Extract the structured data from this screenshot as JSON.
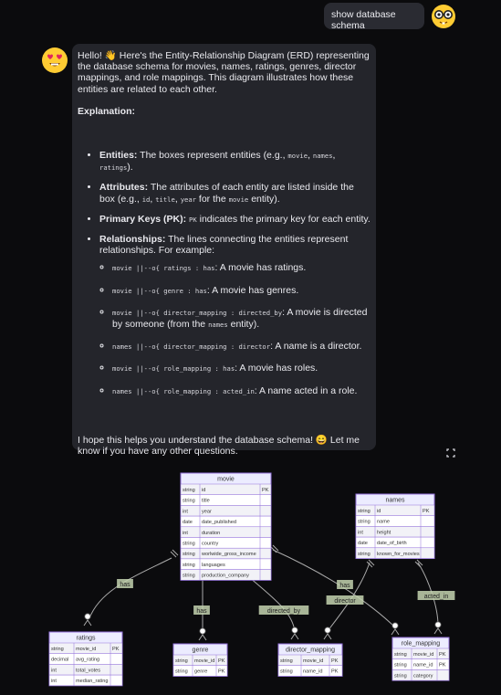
{
  "user_message": "show database schema",
  "assistant": {
    "intro": "Hello! 👋 Here's the Entity-Relationship Diagram (ERD) representing the database schema for movies, names, ratings, genres, director mappings, and role mappings. This diagram illustrates how these entities are related to each other.",
    "explanation_heading": "Explanation:",
    "bullets": {
      "entities_label": "Entities:",
      "entities_text_a": "The boxes represent entities (e.g.,",
      "entities_code1": "movie",
      "entities_code2": "names",
      "entities_code3": "ratings",
      "entities_text_b": ").",
      "attributes_label": "Attributes:",
      "attributes_text_a": "The attributes of each entity are listed inside the box (e.g.,",
      "attributes_code1": "id",
      "attributes_code2": "title",
      "attributes_code3": "year",
      "attributes_text_b": "for the",
      "attributes_code4": "movie",
      "attributes_text_c": "entity).",
      "pk_label": "Primary Keys (PK):",
      "pk_code": "PK",
      "pk_text": "indicates the primary key for each entity.",
      "rel_label": "Relationships:",
      "rel_text": "The lines connecting the entities represent relationships. For example:"
    },
    "examples": [
      {
        "code": "movie ||--o{ ratings : has",
        "text": ": A movie has ratings."
      },
      {
        "code": "movie ||--o{ genre : has",
        "text": ": A movie has genres."
      },
      {
        "code": "movie ||--o{ director_mapping : directed_by",
        "text": ": A movie is directed by someone (from the",
        "code2": "names",
        "text2": "entity)."
      },
      {
        "code": "names ||--o{ director_mapping : director",
        "text": ": A name is a director."
      },
      {
        "code": "movie ||--o{ role_mapping : has",
        "text": ": A movie has roles."
      },
      {
        "code": "names ||--o{ role_mapping : acted_in",
        "text": ": A name acted in a role."
      }
    ],
    "closing": "I hope this helps you understand the database schema! 😄 Let me know if you have any other questions."
  },
  "erd": {
    "entities": {
      "movie": {
        "title": "movie",
        "rows": [
          [
            "string",
            "id",
            "PK"
          ],
          [
            "string",
            "title",
            ""
          ],
          [
            "int",
            "year",
            ""
          ],
          [
            "date",
            "date_published",
            ""
          ],
          [
            "int",
            "duration",
            ""
          ],
          [
            "string",
            "country",
            ""
          ],
          [
            "string",
            "worlwide_gross_income",
            ""
          ],
          [
            "string",
            "languages",
            ""
          ],
          [
            "string",
            "production_company",
            ""
          ]
        ]
      },
      "names": {
        "title": "names",
        "rows": [
          [
            "string",
            "id",
            "PK"
          ],
          [
            "string",
            "name",
            ""
          ],
          [
            "int",
            "height",
            ""
          ],
          [
            "date",
            "date_of_birth",
            ""
          ],
          [
            "string",
            "known_for_movies",
            ""
          ]
        ]
      },
      "ratings": {
        "title": "ratings",
        "rows": [
          [
            "string",
            "movie_id",
            "PK"
          ],
          [
            "decimal",
            "avg_rating",
            ""
          ],
          [
            "int",
            "total_votes",
            ""
          ],
          [
            "int",
            "median_rating",
            ""
          ]
        ]
      },
      "genre": {
        "title": "genre",
        "rows": [
          [
            "string",
            "movie_id",
            "PK"
          ],
          [
            "string",
            "genre",
            "PK"
          ]
        ]
      },
      "director_mapping": {
        "title": "director_mapping",
        "rows": [
          [
            "string",
            "movie_id",
            "PK"
          ],
          [
            "string",
            "name_id",
            "PK"
          ]
        ]
      },
      "role_mapping": {
        "title": "role_mapping",
        "rows": [
          [
            "string",
            "movie_id",
            "PK"
          ],
          [
            "string",
            "name_id",
            "PK"
          ],
          [
            "string",
            "category",
            ""
          ]
        ]
      }
    },
    "relationship_labels": [
      "has",
      "has",
      "directed_by",
      "has",
      "director",
      "acted_in"
    ],
    "colors": {
      "entity_fill": "#ececff",
      "entity_stroke": "#9370db",
      "line": "#aaaaaa",
      "label_bg": "#c4d4b0"
    }
  }
}
